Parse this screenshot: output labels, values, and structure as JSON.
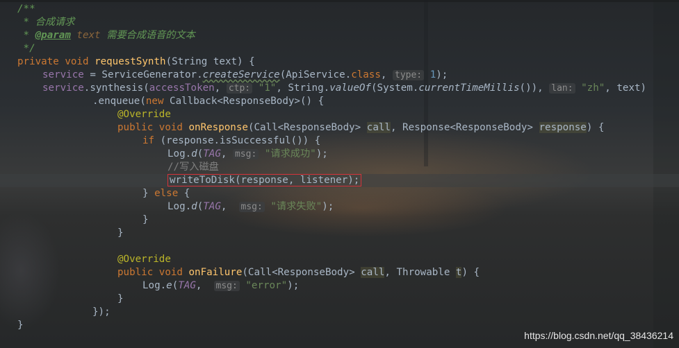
{
  "lines": {
    "l1": "/**",
    "l2_star": " * ",
    "l2_text": "合成请求",
    "l3_star": " * ",
    "l3_tag": "@param",
    "l3_name": "text",
    "l3_desc": "需要合成语音的文本",
    "l4": " */",
    "l5": {
      "k1": "private",
      "k2": "void",
      "fn": "requestSynth",
      "p1": "(String text) {"
    },
    "l6": {
      "f": "service",
      "a": " = ServiceGenerator.",
      "m": "createService",
      "b": "(ApiService.",
      "k": "class",
      "c": ", ",
      "h": "type:",
      "n": "1",
      "d": ");"
    },
    "l7": {
      "f": "service",
      "a": ".synthesis(",
      "f2": "accessToken",
      "c": ", ",
      "h1": "ctp:",
      "s1": "\"1\"",
      "b": ", String.",
      "m1": "valueOf",
      "d": "(System.",
      "m2": "currentTimeMillis",
      "e": "()), ",
      "h2": "lan:",
      "s2": "\"zh\"",
      "g": ", text)"
    },
    "l8": {
      "a": ".enqueue(",
      "k": "new",
      "b": " Callback<ResponseBody>() {"
    },
    "l9": "@Override",
    "l10": {
      "k1": "public",
      "k2": "void",
      "fn": "onResponse",
      "a": "(Call<ResponseBody> ",
      "p1": "call",
      "b": ", Response<ResponseBody> ",
      "p2": "response",
      "c": ") {"
    },
    "l11": {
      "k": "if",
      "a": " (response.isSuccessful()) {"
    },
    "l12": {
      "a": "Log.",
      "m": "d",
      "b": "(",
      "f": "TAG",
      "c": ", ",
      "h": "msg:",
      "s": "\"请求成功\"",
      "d": ");"
    },
    "l13": "//写入磁盘",
    "l14": "writeToDisk(response, listener);",
    "l15": {
      "a": "} ",
      "k": "else",
      "b": " {"
    },
    "l16": {
      "a": "Log.",
      "m": "d",
      "b": "(",
      "f": "TAG",
      "c": ",  ",
      "h": "msg:",
      "s": "\"请求失败\"",
      "d": ");"
    },
    "l17": "}",
    "l18": "}",
    "l20": "@Override",
    "l21": {
      "k1": "public",
      "k2": "void",
      "fn": "onFailure",
      "a": "(Call<ResponseBody> ",
      "p1": "call",
      "b": ", Throwable ",
      "p2": "t",
      "c": ") {"
    },
    "l22": {
      "a": "Log.",
      "m": "e",
      "b": "(",
      "f": "TAG",
      "c": ",  ",
      "h": "msg:",
      "s": "\"error\"",
      "d": ");"
    },
    "l23": "}",
    "l24": "});",
    "l25": "}"
  },
  "watermark": "https://blog.csdn.net/qq_38436214",
  "colors": {
    "keyword": "#cc7832",
    "function": "#ffc66d",
    "string": "#6a8759",
    "number": "#6897bb",
    "field": "#9876aa",
    "comment": "#629755",
    "annotation": "#bbb529",
    "highlight_box": "#d6333a"
  }
}
